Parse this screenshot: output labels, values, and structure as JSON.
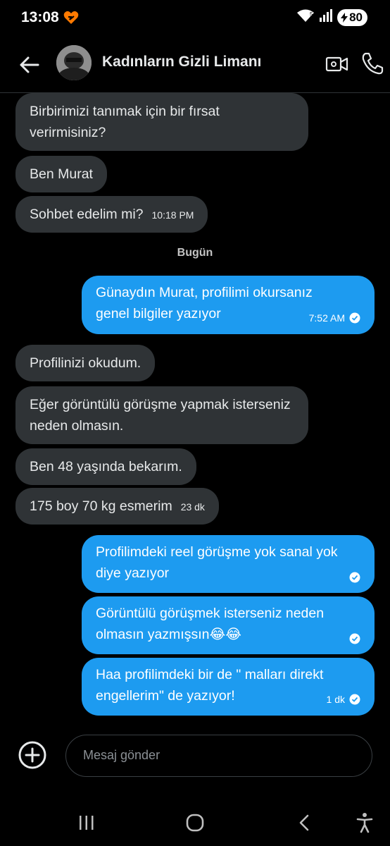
{
  "status_bar": {
    "time": "13:08",
    "battery": "80"
  },
  "header": {
    "title": "Kadınların Gizli Limanı"
  },
  "messages_before": [
    {
      "text": "Birbirimizi tanımak için bir fırsat verirmisiniz?"
    },
    {
      "text": "Ben Murat"
    },
    {
      "text": "Sohbet edelim mi?",
      "time": "10:18 PM"
    }
  ],
  "day_divider": "Bugün",
  "outgoing_1": {
    "text": "Günaydın Murat, profilimi okursanız genel bilgiler yazıyor",
    "time": "7:52 AM"
  },
  "messages_after": [
    {
      "text": "Profilinizi okudum."
    },
    {
      "text": "Eğer görüntülü görüşme yapmak isterseniz neden olmasın."
    },
    {
      "text": "Ben 48 yaşında bekarım."
    },
    {
      "text": "175 boy 70 kg esmerim",
      "time": "23 dk"
    }
  ],
  "outgoing_2": [
    {
      "text": "Profilimdeki reel görüşme yok sanal yok diye yazıyor",
      "time": ""
    },
    {
      "text": "Görüntülü görüşmek isterseniz neden olmasın yazmışsın😂😂",
      "time": ""
    },
    {
      "text": "Haa profilimdeki bir de \" malları direkt engellerim\" de yazıyor!",
      "time": "1 dk"
    }
  ],
  "composer": {
    "placeholder": "Mesaj gönder"
  },
  "colors": {
    "incoming": "#2f3336",
    "outgoing": "#1d9bf0",
    "background": "#000000"
  }
}
